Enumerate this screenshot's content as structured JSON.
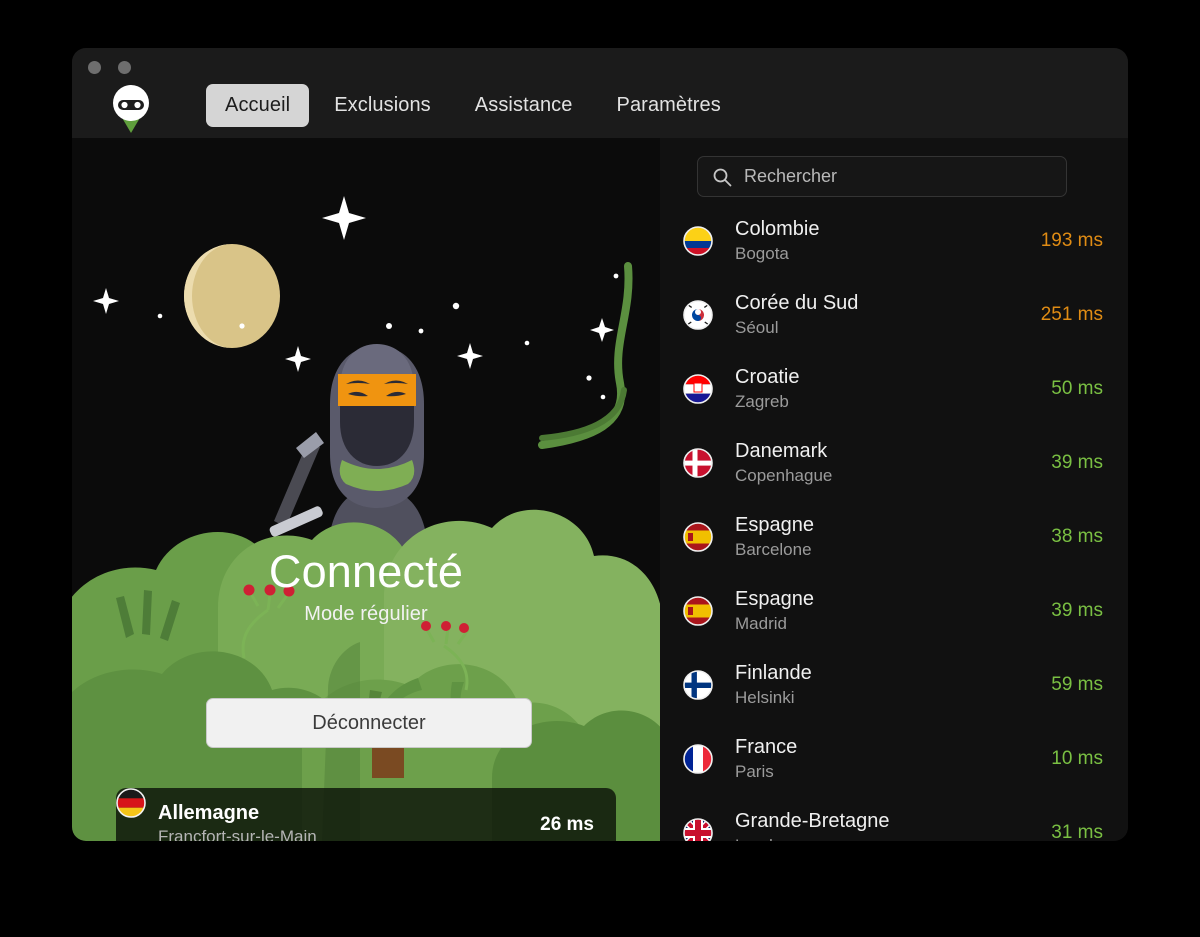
{
  "window": {
    "traffic_lights": [
      "close",
      "minimize"
    ]
  },
  "nav": {
    "logo_name": "ninja-vpn-logo",
    "tabs": [
      {
        "label": "Accueil",
        "active": true
      },
      {
        "label": "Exclusions",
        "active": false
      },
      {
        "label": "Assistance",
        "active": false
      },
      {
        "label": "Paramètres",
        "active": false
      }
    ]
  },
  "status": {
    "title": "Connecté",
    "subtitle": "Mode régulier",
    "disconnect_label": "Déconnecter"
  },
  "current_server": {
    "country": "Allemagne",
    "city": "Francfort-sur-le-Main",
    "ping": "26 ms",
    "flag": "de"
  },
  "search": {
    "placeholder": "Rechercher",
    "value": "",
    "icon": "search-icon"
  },
  "servers": [
    {
      "country": "Colombie",
      "city": "Bogota",
      "ping": "193 ms",
      "ping_state": "slow",
      "flag": "co"
    },
    {
      "country": "Corée du Sud",
      "city": "Séoul",
      "ping": "251 ms",
      "ping_state": "slow",
      "flag": "kr"
    },
    {
      "country": "Croatie",
      "city": "Zagreb",
      "ping": "50 ms",
      "ping_state": "good",
      "flag": "hr"
    },
    {
      "country": "Danemark",
      "city": "Copenhague",
      "ping": "39 ms",
      "ping_state": "good",
      "flag": "dk"
    },
    {
      "country": "Espagne",
      "city": "Barcelone",
      "ping": "38 ms",
      "ping_state": "good",
      "flag": "es"
    },
    {
      "country": "Espagne",
      "city": "Madrid",
      "ping": "39 ms",
      "ping_state": "good",
      "flag": "es"
    },
    {
      "country": "Finlande",
      "city": "Helsinki",
      "ping": "59 ms",
      "ping_state": "good",
      "flag": "fi"
    },
    {
      "country": "France",
      "city": "Paris",
      "ping": "10 ms",
      "ping_state": "good",
      "flag": "fr"
    },
    {
      "country": "Grande-Bretagne",
      "city": "Londres",
      "ping": "31 ms",
      "ping_state": "good",
      "flag": "gb"
    }
  ],
  "colors": {
    "accent_green": "#7ac043",
    "accent_orange": "#e08c14",
    "window_bg": "#111111",
    "titlebar_bg": "#1b1b1b",
    "active_tab_bg": "#d5d5d5"
  }
}
